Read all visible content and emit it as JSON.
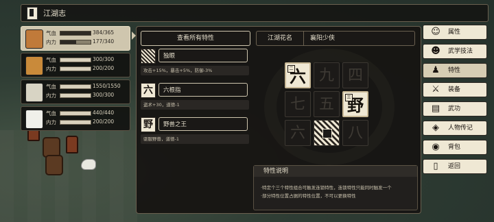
{
  "topbar": {
    "title": "江湖志"
  },
  "characters": [
    {
      "hp_label": "气血",
      "mp_label": "内力",
      "hp": "384/365",
      "mp": "177/340",
      "hp_frac": 1.0,
      "mp_frac": 0.52,
      "selected": true
    },
    {
      "hp_label": "气血",
      "mp_label": "内力",
      "hp": "300/300",
      "mp": "200/200",
      "hp_frac": 1.0,
      "mp_frac": 1.0
    },
    {
      "hp_label": "气血",
      "mp_label": "内力",
      "hp": "1550/1550",
      "mp": "300/300",
      "hp_frac": 1.0,
      "mp_frac": 1.0
    },
    {
      "hp_label": "气血",
      "mp_label": "内力",
      "hp": "440/440",
      "mp": "200/200",
      "hp_frac": 1.0,
      "mp_frac": 1.0
    }
  ],
  "panel": {
    "view_all": "查看所有特性",
    "nick_label": "江湖花名",
    "nick_value": "襄阳少侠",
    "traits": [
      {
        "icon": "",
        "name": "独眼",
        "desc": "攻击+15%，暴击+5%，防御-3%"
      },
      {
        "icon": "六",
        "name": "六根指",
        "desc": "盗术+30，道德-1"
      },
      {
        "icon": "野",
        "name": "野兽之王",
        "desc": "驱服野兽，道德-1"
      }
    ],
    "grid": [
      {
        "ch": "六",
        "tag": "二",
        "active": true
      },
      {
        "ch": "九",
        "active": false
      },
      {
        "ch": "四",
        "active": false
      },
      {
        "ch": "七",
        "active": false
      },
      {
        "ch": "五",
        "active": false
      },
      {
        "ch": "野",
        "tag": "三",
        "active": true
      },
      {
        "ch": "六",
        "active": false
      },
      {
        "ch": "",
        "image": true
      },
      {
        "ch": "八",
        "active": false
      }
    ],
    "desc_title": "特性说明",
    "desc_lines": [
      "·特定个三个特性组合可触发连锁特性，连锁特性只能同时触发一个",
      "·部分特性位置占据的特性位置，不可以更换特性"
    ]
  },
  "menu": [
    {
      "label": "属性",
      "icon": "person-icon",
      "glyph": "☺"
    },
    {
      "label": "武学技法",
      "icon": "skill-icon",
      "glyph": "☻"
    },
    {
      "label": "特性",
      "icon": "trait-icon",
      "glyph": "♟",
      "selected": true
    },
    {
      "label": "装备",
      "icon": "sword-icon",
      "glyph": "⚔"
    },
    {
      "label": "武功",
      "icon": "book-icon",
      "glyph": "▤"
    },
    {
      "label": "人物传记",
      "icon": "scroll-icon",
      "glyph": "◈"
    },
    {
      "label": "背包",
      "icon": "bag-icon",
      "glyph": "◉"
    },
    {
      "label": "返回",
      "icon": "exit-icon",
      "glyph": "▯"
    }
  ]
}
